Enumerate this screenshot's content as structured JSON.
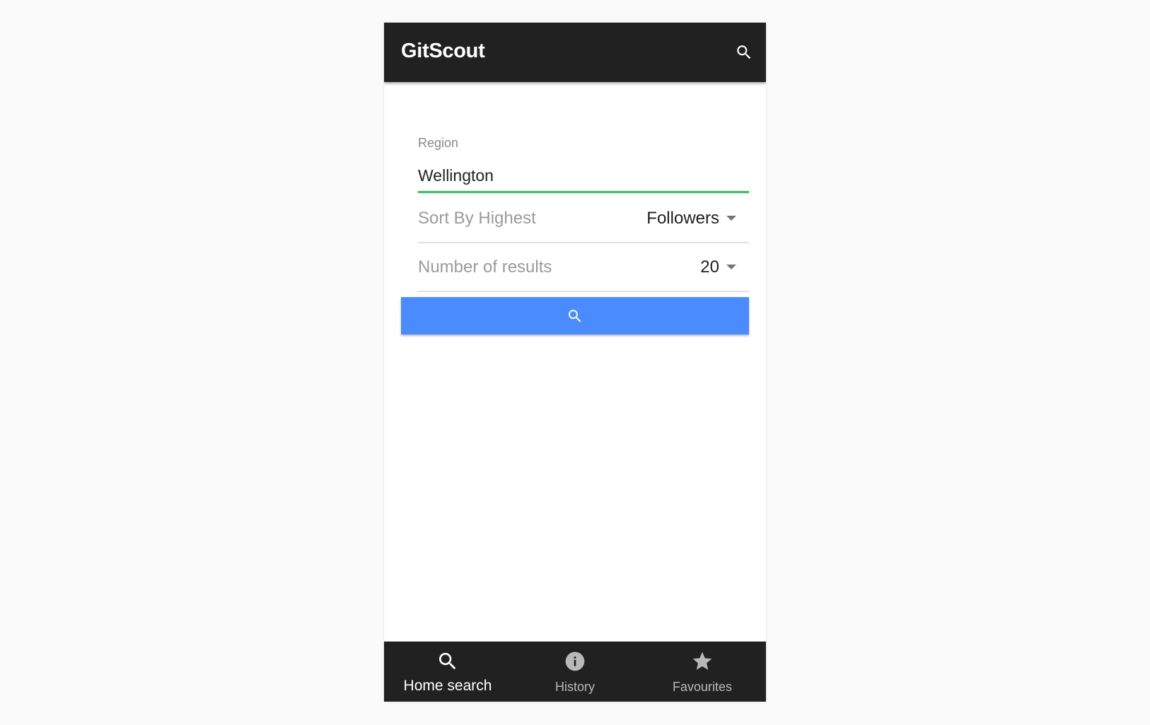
{
  "appbar": {
    "title": "GitScout",
    "search_icon": "search-icon"
  },
  "form": {
    "region": {
      "label": "Region",
      "value": "Wellington"
    },
    "sort": {
      "label": "Sort By Highest",
      "value": "Followers"
    },
    "count": {
      "label": "Number of results",
      "value": "20"
    },
    "search_button_icon": "search-icon"
  },
  "bottom_nav": {
    "items": [
      {
        "label": "Home search",
        "icon": "search-icon",
        "active": true
      },
      {
        "label": "History",
        "icon": "info-icon",
        "active": false
      },
      {
        "label": "Favourites",
        "icon": "star-icon",
        "active": false
      }
    ]
  },
  "colors": {
    "appbar": "#212121",
    "accent_underline": "#2ecc56",
    "button": "#4a8cff",
    "background": "#fafafa"
  }
}
